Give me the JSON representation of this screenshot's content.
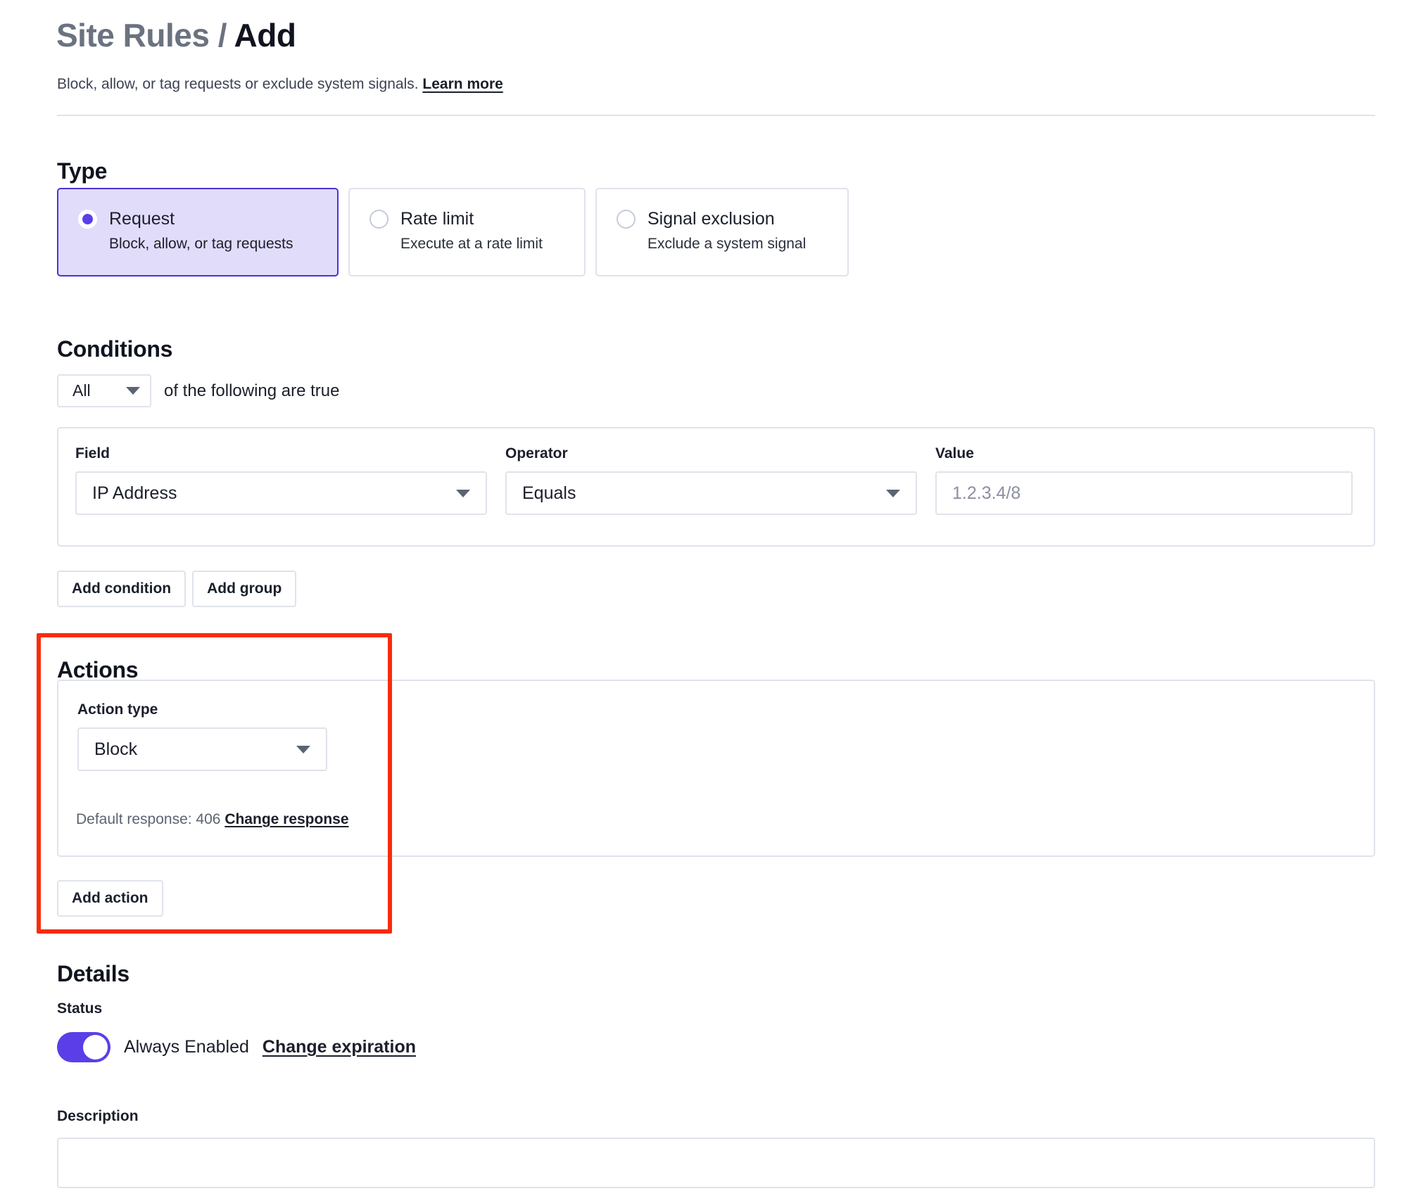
{
  "header": {
    "title_muted": "Site Rules /",
    "title_strong": "Add",
    "subtitle_text": "Block, allow, or tag requests or exclude system signals.",
    "learn_more": "Learn more"
  },
  "type": {
    "heading": "Type",
    "options": [
      {
        "label": "Request",
        "description": "Block, allow, or tag requests",
        "selected": true
      },
      {
        "label": "Rate limit",
        "description": "Execute at a rate limit",
        "selected": false
      },
      {
        "label": "Signal exclusion",
        "description": "Exclude a system signal",
        "selected": false
      }
    ]
  },
  "conditions": {
    "heading": "Conditions",
    "match_value": "All",
    "match_suffix": "of the following are true",
    "field_label": "Field",
    "field_value": "IP Address",
    "operator_label": "Operator",
    "operator_value": "Equals",
    "value_label": "Value",
    "value_placeholder": "1.2.3.4/8",
    "add_condition": "Add condition",
    "add_group": "Add group"
  },
  "actions": {
    "heading": "Actions",
    "action_type_label": "Action type",
    "action_type_value": "Block",
    "default_response_text": "Default response: 406",
    "change_response": "Change response",
    "add_action": "Add action"
  },
  "details": {
    "heading": "Details",
    "status_label": "Status",
    "status_value": "Always Enabled",
    "change_expiration": "Change expiration",
    "description_label": "Description",
    "description_value": ""
  },
  "colors": {
    "accent": "#5b3ee8",
    "accent_border": "#4b31d6",
    "accent_fill": "#e2dcfb",
    "annotation": "#f92c0d",
    "border": "#dfe3eb"
  }
}
